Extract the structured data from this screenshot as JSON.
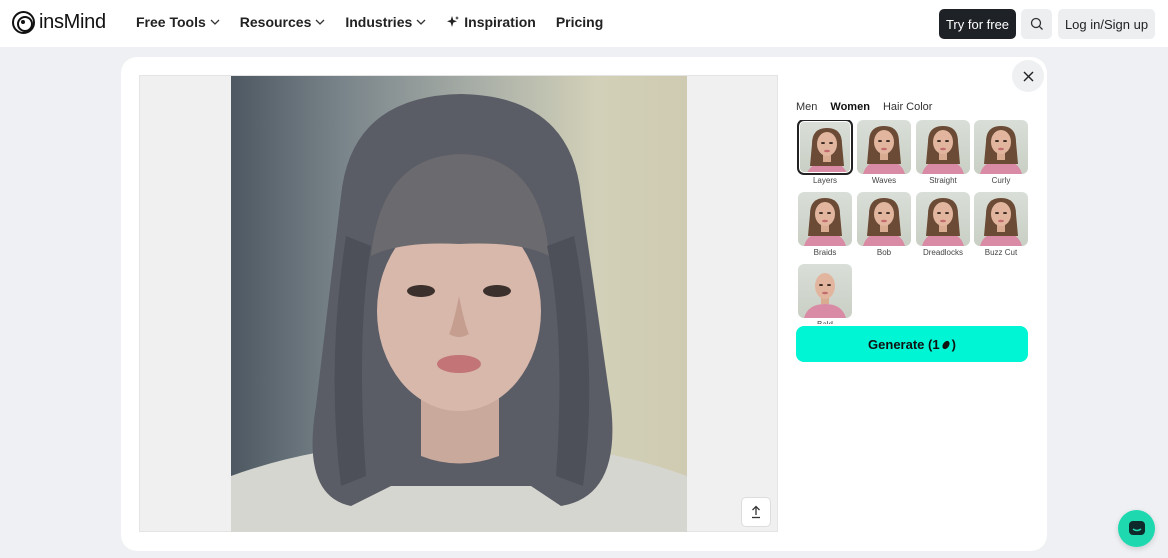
{
  "header": {
    "logo_text": "insMind",
    "nav": [
      {
        "label": "Free Tools",
        "has_dropdown": true
      },
      {
        "label": "Resources",
        "has_dropdown": true
      },
      {
        "label": "Industries",
        "has_dropdown": true
      },
      {
        "label": "Inspiration",
        "has_dropdown": false,
        "icon": "sparkle-icon"
      },
      {
        "label": "Pricing",
        "has_dropdown": false
      }
    ],
    "try_label": "Try for free",
    "login_label": "Log in/Sign up"
  },
  "panel": {
    "tabs": [
      "Men",
      "Women",
      "Hair Color"
    ],
    "active_tab": "Women",
    "styles": [
      "Layers",
      "Waves",
      "Straight",
      "Curly",
      "Braids",
      "Bob",
      "Dreadlocks",
      "Buzz Cut",
      "Bald"
    ],
    "selected_style": "Layers",
    "generate_label": "Generate (1",
    "generate_suffix": ")"
  },
  "colors": {
    "accent": "#00f5d4",
    "dark_button": "#1e2226",
    "chat": "#1ed9b0"
  }
}
